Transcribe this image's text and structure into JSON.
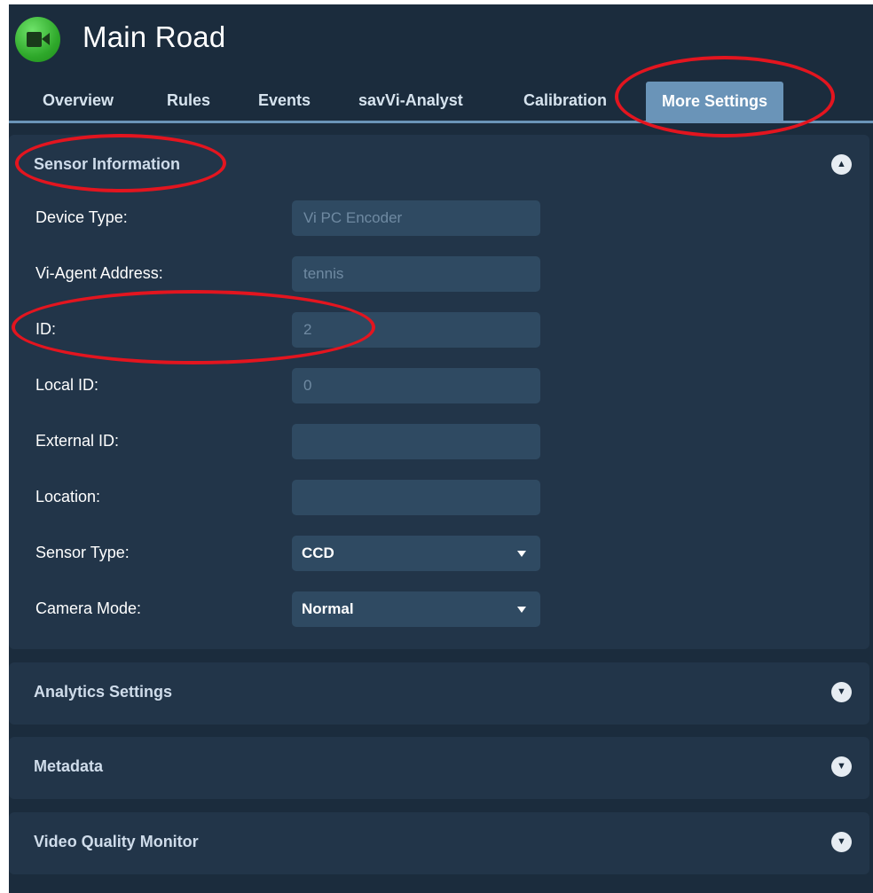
{
  "header": {
    "title": "Main Road",
    "icon": "video-camera-icon",
    "icon_color": "#3cbf37"
  },
  "tabs": [
    {
      "label": "Overview"
    },
    {
      "label": "Rules"
    },
    {
      "label": "Events"
    },
    {
      "label": "savVi-Analyst"
    },
    {
      "label": "Calibration"
    },
    {
      "label": "More Settings",
      "active": true
    }
  ],
  "sensor_information": {
    "title": "Sensor Information",
    "expanded": true,
    "fields": {
      "device_type": {
        "label": "Device Type:",
        "value": "Vi PC Encoder"
      },
      "agent_address": {
        "label": "Vi-Agent Address:",
        "value": "tennis"
      },
      "id": {
        "label": "ID:",
        "value": "2"
      },
      "local_id": {
        "label": "Local ID:",
        "value": "0"
      },
      "external_id": {
        "label": "External ID:",
        "value": ""
      },
      "location": {
        "label": "Location:",
        "value": ""
      },
      "sensor_type": {
        "label": "Sensor Type:",
        "value": "CCD"
      },
      "camera_mode": {
        "label": "Camera Mode:",
        "value": "Normal"
      }
    }
  },
  "collapsed_sections": [
    {
      "title": "Analytics Settings"
    },
    {
      "title": "Metadata"
    },
    {
      "title": "Video Quality Monitor"
    }
  ],
  "colors": {
    "background": "#1b2c3d",
    "panel": "#223549",
    "active_tab": "#6a94b8",
    "annotation": "#e3151f"
  }
}
